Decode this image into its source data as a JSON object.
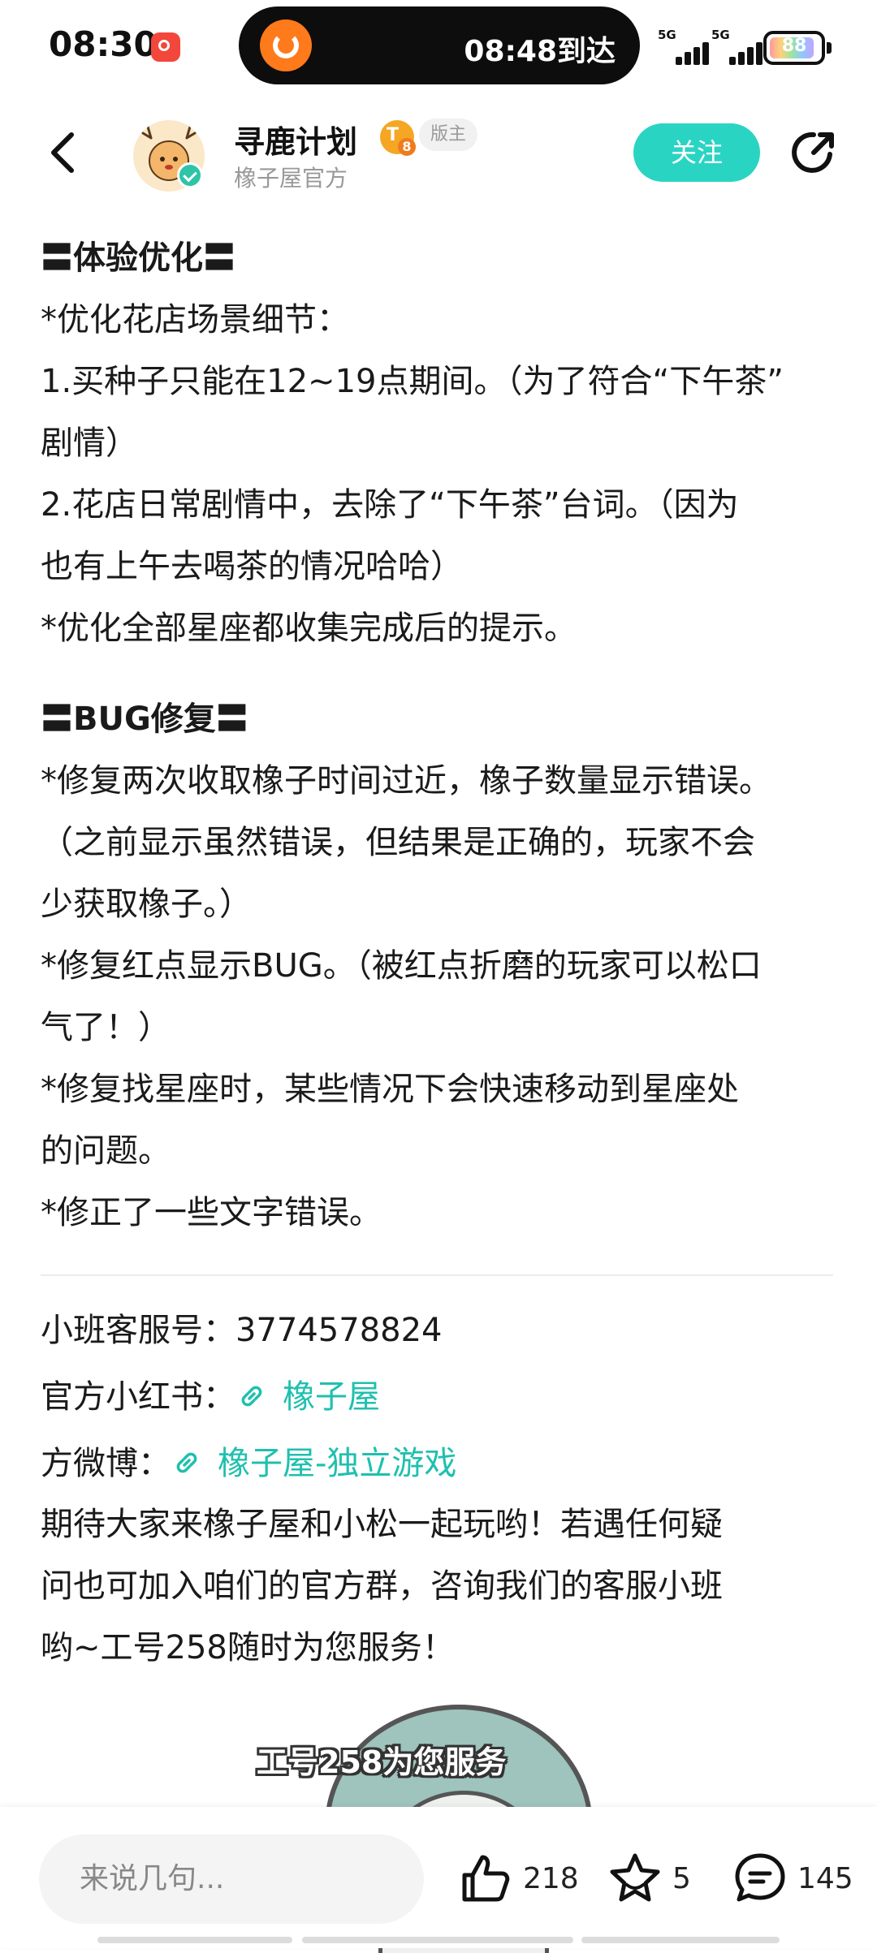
{
  "status_bar": {
    "time": "08:30",
    "island_text": "08:48到达",
    "signal_labels": [
      "5G",
      "5G"
    ],
    "battery_text": "88"
  },
  "header": {
    "name": "寻鹿计划",
    "level": "8",
    "badge": "版主",
    "subname": "橡子屋官方",
    "follow_label": "关注"
  },
  "content": {
    "lines": [
      {
        "text": "〓体验优化〓",
        "bold": true
      },
      {
        "text": "*优化花店场景细节：",
        "bold": false
      },
      {
        "text": "1.买种子只能在12~19点期间。（为了符合“下午茶”",
        "bold": false
      },
      {
        "text": "剧情）",
        "bold": false
      },
      {
        "text": "2.花店日常剧情中，去除了“下午茶”台词。（因为",
        "bold": false
      },
      {
        "text": "也有上午去喝茶的情况哈哈）",
        "bold": false
      },
      {
        "text": "*优化全部星座都收集完成后的提示。",
        "bold": false
      },
      {
        "gap": true
      },
      {
        "text": "〓BUG修复〓",
        "bold": true
      },
      {
        "text": "*修复两次收取橡子时间过近，橡子数量显示错误。",
        "bold": false
      },
      {
        "text": "（之前显示虽然错误，但结果是正确的，玩家不会",
        "bold": false
      },
      {
        "text": "少获取橡子。）",
        "bold": false
      },
      {
        "text": "*修复红点显示BUG。（被红点折磨的玩家可以松口",
        "bold": false
      },
      {
        "text": "气了！）",
        "bold": false
      },
      {
        "text": "*修复找星座时，某些情况下会快速移动到星座处",
        "bold": false
      },
      {
        "text": "的问题。",
        "bold": false
      },
      {
        "text": "*修正了一些文字错误。",
        "bold": false
      }
    ],
    "service_label": "小班客服号：",
    "service_number": "3774578824",
    "xhs_label": "官方小红书：",
    "xhs_link": "橡子屋",
    "weibo_label": "方微博：",
    "weibo_link": "橡子屋-独立游戏",
    "closing_lines": [
      "期待大家来橡子屋和小松一起玩哟！若遇任何疑",
      "问也可加入咱们的官方群，咨询我们的客服小班",
      "哟~工号258随时为您服务！"
    ],
    "image_caption": "工号258为您服务"
  },
  "bottom_bar": {
    "comment_placeholder": "来说几句...",
    "likes": "218",
    "favorites": "5",
    "comments": "145"
  },
  "colors": {
    "accent": "#2ad4c3",
    "link": "#1fc0ae"
  }
}
